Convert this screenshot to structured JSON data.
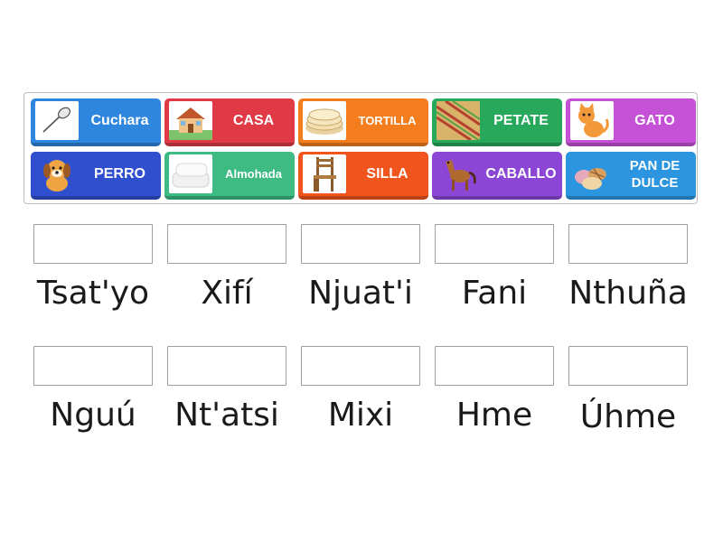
{
  "tiles": [
    {
      "label": "Cuchara",
      "icon": "spoon-icon",
      "color": "#2e86de"
    },
    {
      "label": "CASA",
      "icon": "house-icon",
      "color": "#e03a46"
    },
    {
      "label": "TORTILLA",
      "icon": "tortilla-icon",
      "color": "#f47d1e"
    },
    {
      "label": "PETATE",
      "icon": "mat-icon",
      "color": "#27a85a"
    },
    {
      "label": "GATO",
      "icon": "cat-icon",
      "color": "#c551d6"
    },
    {
      "label": "PERRO",
      "icon": "dog-icon",
      "color": "#2f4fcf"
    },
    {
      "label": "Almohada",
      "icon": "pillow-icon",
      "color": "#3dbb82"
    },
    {
      "label": "SILLA",
      "icon": "chair-icon",
      "color": "#f0551e"
    },
    {
      "label": "CABALLO",
      "icon": "horse-icon",
      "color": "#8b46d6"
    },
    {
      "label": "PAN DE DULCE",
      "icon": "sweet-bread-icon",
      "color": "#2b95e0"
    }
  ],
  "words": [
    {
      "text": "Tsat'yo"
    },
    {
      "text": "Xifí"
    },
    {
      "text": "Njuat'i"
    },
    {
      "text": "Fani"
    },
    {
      "text": "Nthuña"
    },
    {
      "text": "Nguú"
    },
    {
      "text": "Nt'atsi"
    },
    {
      "text": "Mixi"
    },
    {
      "text": "Hme"
    },
    {
      "text": "Úhme"
    }
  ]
}
